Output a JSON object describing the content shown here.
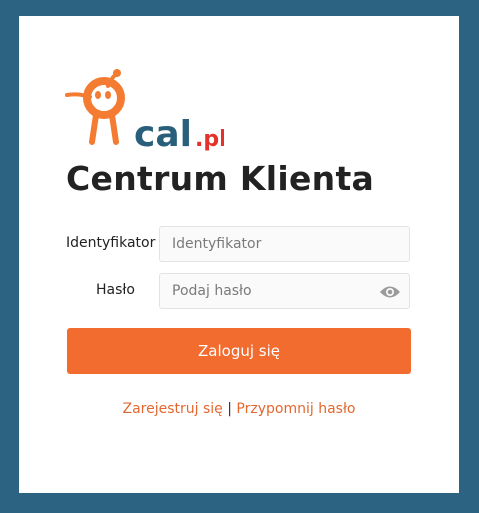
{
  "brand": {
    "logo_text": "cal.pl",
    "logo_main": "cal",
    "logo_suffix": ".pl"
  },
  "page": {
    "title": "Centrum Klienta"
  },
  "form": {
    "identifier": {
      "label": "Identyfikator",
      "placeholder": "Identyfikator",
      "value": ""
    },
    "password": {
      "label": "Hasło",
      "placeholder": "Podaj hasło",
      "value": ""
    },
    "show_password_icon": "eye-icon",
    "login_button_label": "Zaloguj się"
  },
  "links": {
    "register": "Zarejestruj się",
    "separator": "|",
    "remind_password": "Przypomnij hasło"
  },
  "colors": {
    "background": "#2c6383",
    "accent": "#f26b2f",
    "logo_orange": "#f47c32",
    "logo_blue": "#2a5f7c",
    "logo_suffix_red": "#e4322b"
  }
}
